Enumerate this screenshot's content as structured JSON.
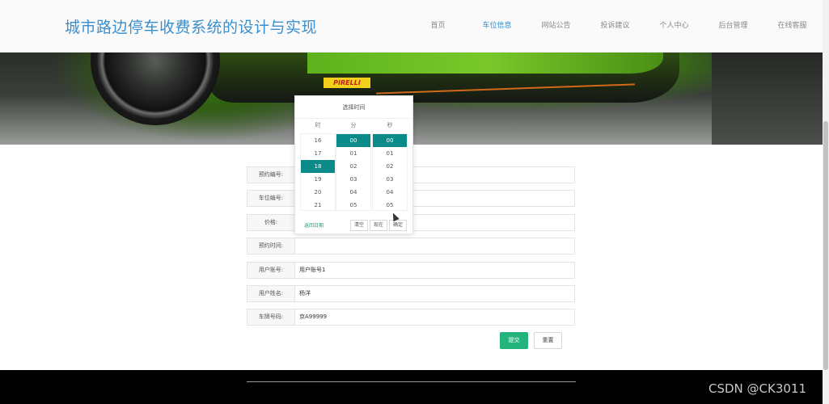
{
  "header": {
    "title": "城市路边停车收费系统的设计与实现",
    "nav": [
      {
        "label": "首页",
        "active": false
      },
      {
        "label": "车位信息",
        "active": true
      },
      {
        "label": "网站公告",
        "active": false
      },
      {
        "label": "投诉建议",
        "active": false
      },
      {
        "label": "个人中心",
        "active": false
      },
      {
        "label": "后台管理",
        "active": false
      },
      {
        "label": "在线客服",
        "active": false
      }
    ]
  },
  "banner": {
    "tire_brand": "PIRELLI"
  },
  "form": {
    "fields": [
      {
        "label": "预约编号:",
        "value": ""
      },
      {
        "label": "车位编号:",
        "value": ""
      },
      {
        "label": "价格:",
        "value": ""
      },
      {
        "label": "预约时间:",
        "value": ""
      },
      {
        "label": "用户账号:",
        "value": "用户账号1"
      },
      {
        "label": "用户姓名:",
        "value": "杨洋"
      },
      {
        "label": "车牌号码:",
        "value": "京A99999"
      }
    ],
    "submit_label": "提交",
    "reset_label": "重置"
  },
  "time_picker": {
    "title": "选择时间",
    "col_hour": "时",
    "col_minute": "分",
    "col_second": "秒",
    "hours": [
      "16",
      "17",
      "18",
      "19",
      "20",
      "21"
    ],
    "minutes": [
      "00",
      "01",
      "02",
      "03",
      "04",
      "05"
    ],
    "seconds": [
      "00",
      "01",
      "02",
      "03",
      "04",
      "05"
    ],
    "selected_hour": "18",
    "selected_minute": "00",
    "selected_second": "00",
    "back_label": "返回日期",
    "clear_label": "清空",
    "now_label": "现在",
    "confirm_label": "确定"
  },
  "watermark": "CSDN @CK3011",
  "colors": {
    "accent": "#0b8a8a",
    "submit": "#23b47e",
    "title": "#3a8fcf"
  }
}
